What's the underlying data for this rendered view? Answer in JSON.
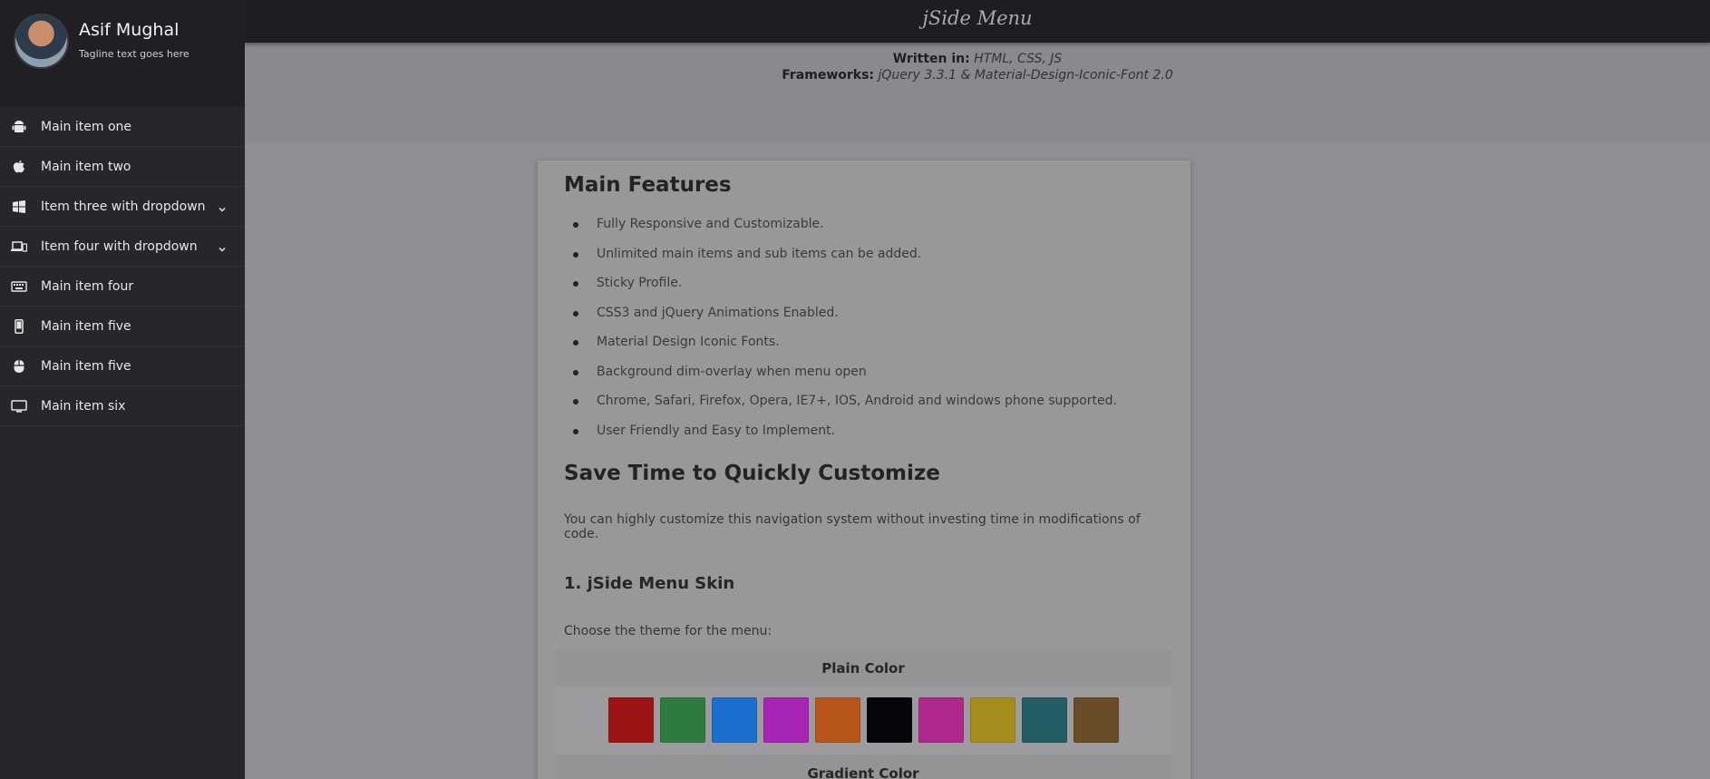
{
  "header": {
    "title": "jSide Menu"
  },
  "profile": {
    "name": "Asif Mughal",
    "tagline": "Tagline text goes here"
  },
  "sidebar": {
    "items": [
      {
        "label": "Main item one",
        "icon": "android-icon",
        "dropdown": false
      },
      {
        "label": "Main item two",
        "icon": "apple-icon",
        "dropdown": false
      },
      {
        "label": "Item three with dropdown",
        "icon": "windows-icon",
        "dropdown": true
      },
      {
        "label": "Item four with dropdown",
        "icon": "devices-icon",
        "dropdown": true
      },
      {
        "label": "Main item four",
        "icon": "keyboard-icon",
        "dropdown": false
      },
      {
        "label": "Main item five",
        "icon": "phone-icon",
        "dropdown": false
      },
      {
        "label": "Main item five",
        "icon": "mouse-icon",
        "dropdown": false
      },
      {
        "label": "Main item six",
        "icon": "monitor-icon",
        "dropdown": false
      }
    ]
  },
  "info": {
    "written_label": "Written in:",
    "written_value": "HTML, CSS, JS",
    "frameworks_label": "Frameworks:",
    "frameworks_value": "jQuery 3.3.1 & Material-Design-Iconic-Font 2.0"
  },
  "content": {
    "features_title": "Main Features",
    "features": [
      "Fully Responsive and Customizable.",
      "Unlimited main items and sub items can be added.",
      "Sticky Profile.",
      "CSS3 and jQuery Animations Enabled.",
      "Material Design Iconic Fonts.",
      "Background dim-overlay when menu open",
      "Chrome, Safari, Firefox, Opera, IE7+, IOS, Android and windows phone supported.",
      "User Friendly and Easy to Implement."
    ],
    "customize_title": "Save Time to Quickly Customize",
    "customize_text": "You can highly customize this navigation system without investing time in modifications of code.",
    "skin_title": "1. jSide Menu Skin",
    "skin_text": "Choose the theme for the menu:",
    "plain_color_label": "Plain Color",
    "gradient_color_label": "Gradient Color",
    "swatches": [
      "#9e1313",
      "#2f7a3f",
      "#1c6fcf",
      "#a824b5",
      "#b7561a",
      "#05060a",
      "#b1288c",
      "#a58d1d",
      "#245d63",
      "#6a4c26"
    ]
  },
  "colors": {
    "overlay_bg": "#8f8e93",
    "sidebar_bg": "#26262b",
    "header_bg": "#1e1e22"
  }
}
